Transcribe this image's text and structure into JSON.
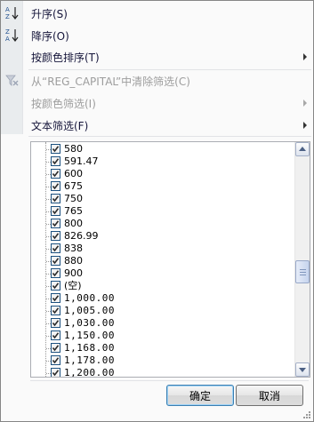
{
  "menu": {
    "items": [
      {
        "label": "升序(S)",
        "icon": "sort-ascending-icon",
        "enabled": true,
        "submenu": false
      },
      {
        "label": "降序(O)",
        "icon": "sort-descending-icon",
        "enabled": true,
        "submenu": false
      },
      {
        "label": "按颜色排序(T)",
        "icon": "",
        "enabled": true,
        "submenu": true
      },
      {
        "label": "从“REG_CAPITAL”中清除筛选(C)",
        "icon": "clear-filter-icon",
        "enabled": false,
        "submenu": false
      },
      {
        "label": "按颜色筛选(I)",
        "icon": "",
        "enabled": false,
        "submenu": true
      },
      {
        "label": "文本筛选(F)",
        "icon": "",
        "enabled": true,
        "submenu": true
      }
    ]
  },
  "list": {
    "items": [
      {
        "label": "580",
        "checked": true
      },
      {
        "label": "591.47",
        "checked": true
      },
      {
        "label": "600",
        "checked": true
      },
      {
        "label": "675",
        "checked": true
      },
      {
        "label": "750",
        "checked": true
      },
      {
        "label": "765",
        "checked": true
      },
      {
        "label": "800",
        "checked": true
      },
      {
        "label": "826.99",
        "checked": true
      },
      {
        "label": "838",
        "checked": true
      },
      {
        "label": "880",
        "checked": true
      },
      {
        "label": "900",
        "checked": true
      },
      {
        "label": "(空)",
        "checked": true
      },
      {
        "label": "1,000.00",
        "checked": true
      },
      {
        "label": "1,005.00",
        "checked": true
      },
      {
        "label": "1,030.00",
        "checked": true
      },
      {
        "label": "1,150.00",
        "checked": true
      },
      {
        "label": "1,168.00",
        "checked": true
      },
      {
        "label": "1,178.00",
        "checked": true
      },
      {
        "label": "1,200.00",
        "checked": true
      }
    ],
    "scroll_position": 0.55
  },
  "buttons": {
    "ok_label": "确定",
    "cancel_label": "取消"
  },
  "colors": {
    "menu_text": "#15153a",
    "disabled_text": "#9d9d9d",
    "checkbox_border": "#1c5180",
    "checkmark": "#2b2b2b"
  }
}
